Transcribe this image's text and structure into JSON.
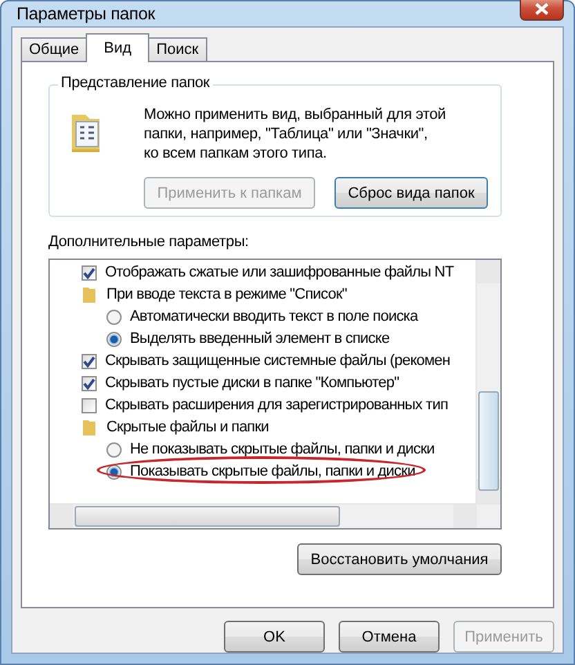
{
  "window": {
    "title": "Параметры папок"
  },
  "tabs": [
    {
      "label": "Общие",
      "selected": false
    },
    {
      "label": "Вид",
      "selected": true
    },
    {
      "label": "Поиск",
      "selected": false
    }
  ],
  "folder_views": {
    "title": "Представление папок",
    "description_lines": [
      "Можно применить вид, выбранный для этой",
      "папки, например, \"Таблица\" или \"Значки\",",
      "ко всем папкам этого типа."
    ],
    "buttons": [
      {
        "label": "Применить к папкам",
        "disabled": true
      },
      {
        "label": "Сброс вида папок",
        "disabled": false
      }
    ]
  },
  "advanced": {
    "label": "Дополнительные параметры:",
    "items": [
      {
        "kind": "checkbox",
        "label": "Отображать сжатые или зашифрованные файлы NT",
        "checked": true,
        "highlighted": false
      },
      {
        "kind": "folder",
        "label": "При вводе текста в режиме \"Список\"",
        "highlighted": false,
        "children": [
          {
            "kind": "radio",
            "label": "Автоматически вводить текст в поле поиска",
            "selected": false,
            "highlighted": false
          },
          {
            "kind": "radio",
            "label": "Выделять введенный элемент в списке",
            "selected": true,
            "highlighted": false
          }
        ]
      },
      {
        "kind": "checkbox",
        "label": "Скрывать защищенные системные файлы (рекомен",
        "checked": true,
        "highlighted": false
      },
      {
        "kind": "checkbox",
        "label": "Скрывать пустые диски в папке \"Компьютер\"",
        "checked": true,
        "highlighted": false
      },
      {
        "kind": "checkbox",
        "label": "Скрывать расширения для зарегистрированных тип",
        "checked": false,
        "highlighted": false
      },
      {
        "kind": "folder",
        "label": "Скрытые файлы и папки",
        "highlighted": false,
        "children": [
          {
            "kind": "radio",
            "label": "Не показывать скрытые файлы, папки и диски",
            "selected": false,
            "highlighted": false
          },
          {
            "kind": "radio",
            "label": "Показывать скрытые файлы, папки и диски",
            "selected": true,
            "highlighted": true
          }
        ]
      }
    ],
    "restore_button": "Восстановить умолчания"
  },
  "buttons": [
    {
      "label": "OK",
      "disabled": false
    },
    {
      "label": "Отмена",
      "disabled": false
    },
    {
      "label": "Применить",
      "disabled": true
    }
  ]
}
